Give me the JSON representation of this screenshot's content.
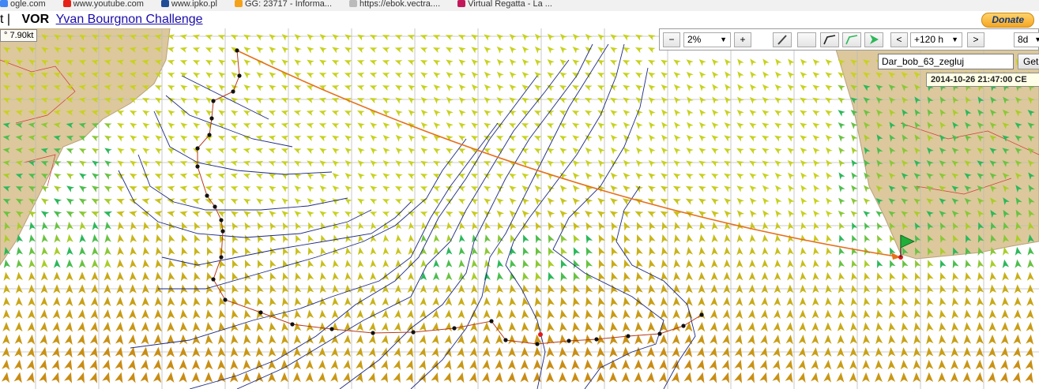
{
  "bookmarks": [
    {
      "label": "ogle.com",
      "icon": "google-icon",
      "color": "#4285f4"
    },
    {
      "label": "www.youtube.com",
      "icon": "youtube-icon",
      "color": "#e62117"
    },
    {
      "label": "www.ipko.pl",
      "icon": "bank-icon",
      "color": "#1f4e96"
    },
    {
      "label": "GG: 23717 - Informa...",
      "icon": "gg-icon",
      "color": "#f3a21a"
    },
    {
      "label": "https://ebok.vectra....",
      "icon": "page-icon",
      "color": "#bbbbbb"
    },
    {
      "label": "Virtual Regatta - La ...",
      "icon": "regatta-icon",
      "color": "#c2185b"
    }
  ],
  "title": {
    "prefix": "t |",
    "vor": "VOR",
    "link": "Yvan Bourgnon Challenge"
  },
  "donate_label": "Donate",
  "wind_speed": "° 7.90kt",
  "toolbar": {
    "zoom_minus": "−",
    "zoom_value": "2%",
    "zoom_plus": "+",
    "prev": "<",
    "time_value": "+120 h",
    "next": ">",
    "days_value": "8d"
  },
  "boat_input": "Dar_bob_63_zegluj",
  "get_button": "Get",
  "datetime": "2014-10-26 21:47:00 CE",
  "colors": {
    "land": "#dcc89c",
    "sea": "#ffffff",
    "arrow_light": "#c8d21e",
    "arrow_dark": "#c98c14",
    "arrow_green": "#2cb85a",
    "isobar": "#1d2a80",
    "route": "#e5701a",
    "track": "#b73a1a",
    "grid": "#bcbcbc"
  }
}
